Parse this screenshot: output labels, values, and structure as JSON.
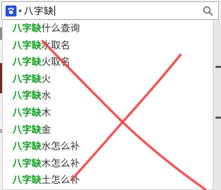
{
  "search": {
    "engine_icon": "paw-icon",
    "query": "八字缺",
    "submit_icon": "search-icon"
  },
  "suggestions": [
    {
      "prefix": "八字缺",
      "rest": "什么查询"
    },
    {
      "prefix": "八字缺",
      "rest": "水取名"
    },
    {
      "prefix": "八字缺",
      "rest": "火取名"
    },
    {
      "prefix": "八字缺",
      "rest": "火"
    },
    {
      "prefix": "八字缺",
      "rest": "水"
    },
    {
      "prefix": "八字缺",
      "rest": "木"
    },
    {
      "prefix": "八字缺",
      "rest": "金"
    },
    {
      "prefix": "八字缺",
      "rest": "水怎么补"
    },
    {
      "prefix": "八字缺",
      "rest": "木怎么补"
    },
    {
      "prefix": "八字缺",
      "rest": "土怎么补"
    }
  ],
  "colors": {
    "highlight": "#0f9d1f",
    "cross": "#ee4444",
    "engine_icon_bg": "#2b4fd6"
  },
  "overlay": "red-x-mark"
}
